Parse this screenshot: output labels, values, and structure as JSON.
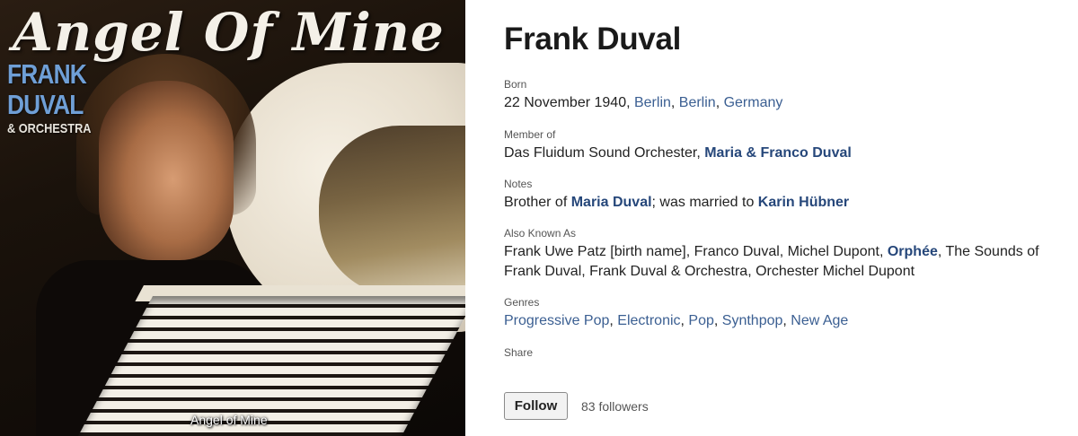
{
  "cover": {
    "title_script": "Angel Of Mine",
    "logo_line1": "FRANK",
    "logo_line2": "DUVAL",
    "logo_line3": "& ORCHESTRA",
    "caption": "Angel of Mine"
  },
  "artist": {
    "name": "Frank Duval",
    "born_label": "Born",
    "born_date": "22 November 1940,",
    "born_places": [
      "Berlin",
      "Berlin",
      "Germany"
    ],
    "member_label": "Member of",
    "member_plain": "Das Fluidum Sound Orchester,",
    "member_link": "Maria & Franco Duval",
    "notes_label": "Notes",
    "notes_pre": "Brother of",
    "notes_link1": "Maria Duval",
    "notes_mid": "; was married to",
    "notes_link2": "Karin Hübner",
    "aka_label": "Also Known As",
    "aka_pre": "Frank Uwe Patz [birth name], Franco Duval, Michel Dupont,",
    "aka_link": "Orphée",
    "aka_post": ", The Sounds of Frank Duval, Frank Duval & Orchestra, Orchester Michel Dupont",
    "genres_label": "Genres",
    "genres": [
      "Progressive Pop",
      "Electronic",
      "Pop",
      "Synthpop",
      "New Age"
    ],
    "share_label": "Share",
    "follow_label": "Follow",
    "followers": "83 followers"
  },
  "colors": {
    "link": "#3b5f92",
    "link_bold": "#26477a",
    "logo_blue": "#6f9fd6"
  }
}
